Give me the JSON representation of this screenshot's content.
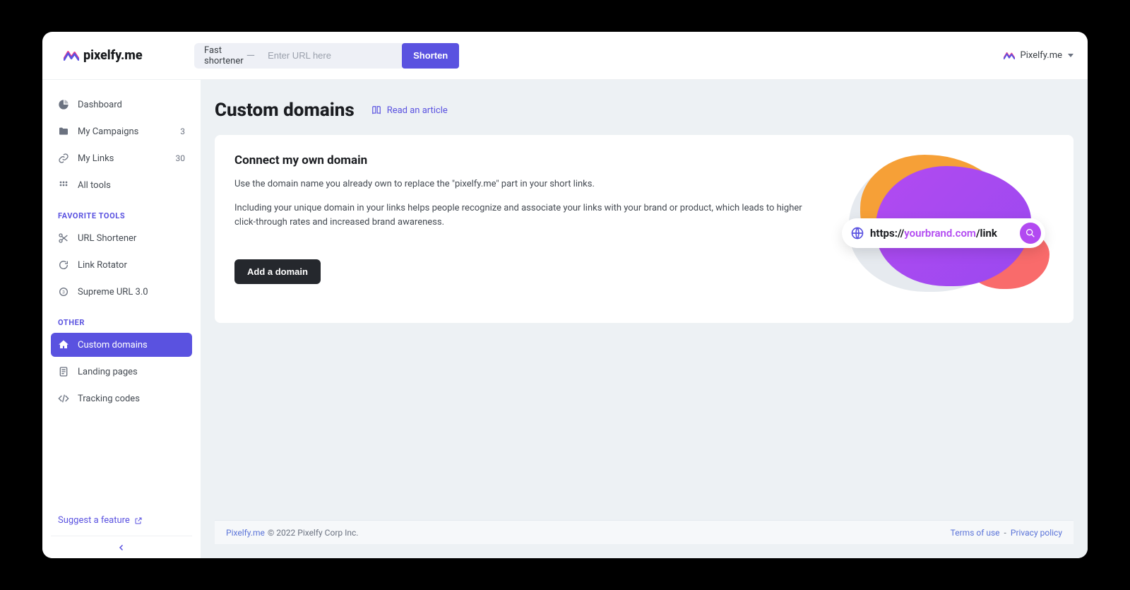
{
  "brand": {
    "name": "pixelfy.me"
  },
  "topbar": {
    "shortener_prefix": "Fast shortener",
    "shortener_placeholder": "Enter URL here",
    "shorten_button": "Shorten",
    "user_label": "Pixelfy.me"
  },
  "sidebar": {
    "main": [
      {
        "label": "Dashboard"
      },
      {
        "label": "My Campaigns",
        "count": "3"
      },
      {
        "label": "My Links",
        "count": "30"
      },
      {
        "label": "All tools"
      }
    ],
    "section_fav": "FAVORITE TOOLS",
    "fav": [
      {
        "label": "URL Shortener"
      },
      {
        "label": "Link Rotator"
      },
      {
        "label": "Supreme URL 3.0"
      }
    ],
    "section_other": "OTHER",
    "other": [
      {
        "label": "Custom domains"
      },
      {
        "label": "Landing pages"
      },
      {
        "label": "Tracking codes"
      }
    ],
    "suggest": "Suggest a feature"
  },
  "page": {
    "title": "Custom domains",
    "read_article": "Read an article",
    "card_title": "Connect my own domain",
    "card_desc_1": "Use the domain name you already own to replace the \"pixelfy.me\" part in your short links.",
    "card_desc_2": "Including your unique domain in your links helps people recognize and associate your links with your brand or product, which leads to higher click-through rates and increased brand awareness.",
    "add_domain": "Add a domain",
    "pill_prefix": "https://",
    "pill_brand": "yourbrand.com",
    "pill_suffix": "/link"
  },
  "footer": {
    "brand_link": "Pixelfy.me",
    "copyright": "© 2022 Pixelfy Corp Inc.",
    "terms": "Terms of use",
    "privacy": "Privacy policy",
    "sep": "-"
  }
}
